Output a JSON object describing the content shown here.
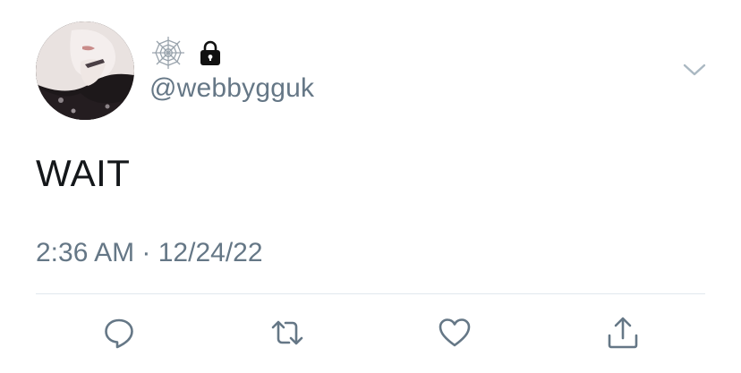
{
  "tweet": {
    "display_name_icons": [
      "spider-web-icon",
      "lock-icon"
    ],
    "handle": "@webbygguk",
    "text": "WAIT",
    "time": "2:36 AM",
    "separator": " · ",
    "date": "12/24/22"
  },
  "actions": [
    {
      "icon": "reply-icon"
    },
    {
      "icon": "retweet-icon"
    },
    {
      "icon": "like-icon"
    },
    {
      "icon": "share-icon"
    }
  ],
  "colors": {
    "text": "#14171a",
    "secondary": "#657786",
    "icon": "#657786",
    "divider": "#e1e8ed"
  }
}
